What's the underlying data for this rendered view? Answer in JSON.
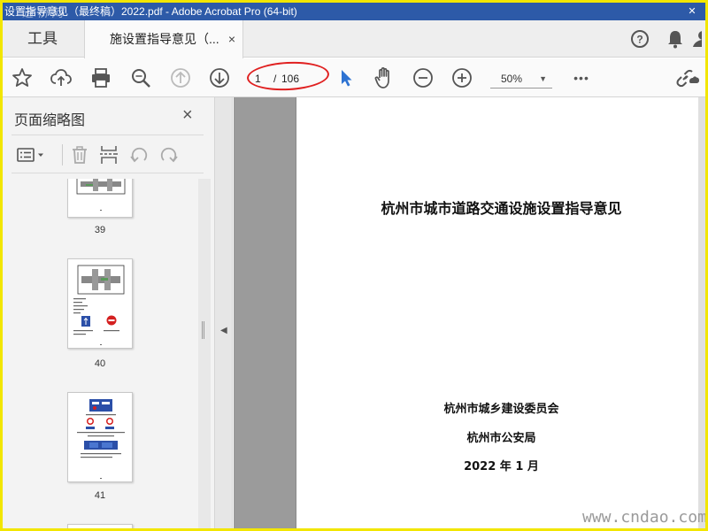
{
  "window": {
    "title": "设置指导意见（最终稿）2022.pdf - Adobe Acrobat Pro (64-bit)",
    "watermark_logo": "道桥网",
    "controls": [
      "close-icon"
    ]
  },
  "tabs": {
    "tools_label": "工具",
    "doc_tab_label": "施设置指导意见（...",
    "doc_tab_close": "×"
  },
  "header_icons": [
    "help-icon",
    "bell-icon",
    "account-icon"
  ],
  "toolbar": {
    "icons": [
      "star-icon",
      "cloud-upload-icon",
      "print-icon",
      "search-icon",
      "arrow-up-icon",
      "arrow-down-icon",
      "select-arrow-icon",
      "hand-icon",
      "zoom-out-icon",
      "zoom-in-icon",
      "more-icon",
      "share-link-icon"
    ],
    "page_current": "1",
    "page_separator": "/",
    "page_total": "106",
    "zoom_value": "50%",
    "more_label": "•••",
    "accent_color": "#2d73d2",
    "highlight_color": "#e02020"
  },
  "sidebar": {
    "title": "页面缩略图",
    "close": "×",
    "tool_icons": [
      "options-icon",
      "delete-icon",
      "insert-page-icon",
      "rotate-left-icon",
      "rotate-right-icon"
    ],
    "thumbnails": [
      {
        "label": "39"
      },
      {
        "label": "40"
      },
      {
        "label": "41"
      }
    ]
  },
  "document": {
    "title": "杭州市城市道路交通设施设置指导意见",
    "issuer1": "杭州市城乡建设委员会",
    "issuer2": "杭州市公安局",
    "date": "2022 年 1 月"
  },
  "footer_watermark": "www.cndao.com"
}
